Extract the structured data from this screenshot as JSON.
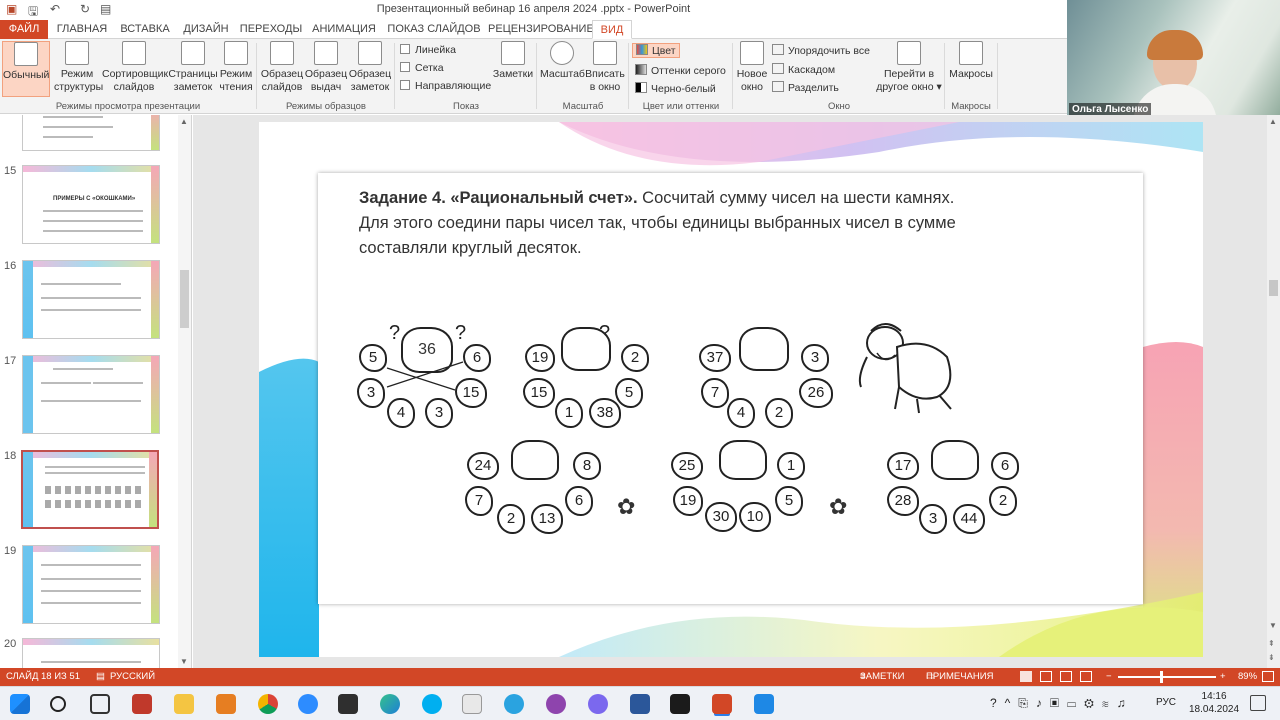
{
  "app": {
    "title": "Презентационный вебинар 16 апреля 2024 .pptx - PowerPoint",
    "quick_access": [
      "save-icon",
      "undo-icon",
      "redo-icon",
      "slideshow-icon"
    ]
  },
  "tabs": [
    "ФАЙЛ",
    "ГЛАВНАЯ",
    "ВСТАВКА",
    "ДИЗАЙН",
    "ПЕРЕХОДЫ",
    "АНИМАЦИЯ",
    "ПОКАЗ СЛАЙДОВ",
    "РЕЦЕНЗИРОВАНИЕ",
    "ВИД"
  ],
  "active_tab": "ВИД",
  "ribbon": {
    "views": {
      "normal": "Обычный",
      "outline_1": "Режим",
      "outline_2": "структуры",
      "sorter_1": "Сортировщик",
      "sorter_2": "слайдов",
      "notes_1": "Страницы",
      "notes_2": "заметок",
      "reading_1": "Режим",
      "reading_2": "чтения",
      "group": "Режимы просмотра презентации"
    },
    "masters": {
      "slide_1": "Образец",
      "slide_2": "слайдов",
      "handout_1": "Образец",
      "handout_2": "выдач",
      "notes_1": "Образец",
      "notes_2": "заметок",
      "group": "Режимы образцов"
    },
    "show": {
      "ruler": "Линейка",
      "grid": "Сетка",
      "guides": "Направляющие",
      "notes": "Заметки",
      "group": "Показ"
    },
    "zoom": {
      "zoom": "Масштаб",
      "fit_1": "Вписать",
      "fit_2": "в окно",
      "group": "Масштаб"
    },
    "color": {
      "color": "Цвет",
      "gray": "Оттенки серого",
      "bw": "Черно-белый",
      "group": "Цвет или оттенки серого"
    },
    "window": {
      "new_1": "Новое",
      "new_2": "окно",
      "arrange": "Упорядочить все",
      "cascade": "Каскадом",
      "split": "Разделить",
      "switch_1": "Перейти в",
      "switch_2": "другое окно",
      "group": "Окно"
    },
    "macros": {
      "macros": "Макросы",
      "group": "Макросы"
    }
  },
  "webcam": {
    "name": "Ольга Лысенко"
  },
  "thumbnails": {
    "numbers": [
      "15",
      "16",
      "17",
      "18",
      "19",
      "20"
    ],
    "titles": [
      "ПРИМЕРЫ С «ОКОШКАМИ»",
      "",
      "",
      "",
      "",
      ""
    ],
    "selected": "18"
  },
  "slide": {
    "task_bold": "Задание 4. «Рациональный счет».",
    "task_text": " Сосчитай сумму чисел на шести камнях. Для этого соедини пары чисел так, чтобы единицы выбранных чисел в сумме составляли круглый десяток.",
    "groups": [
      {
        "big": "36",
        "stones": [
          "5",
          "6",
          "3",
          "15",
          "4",
          "3"
        ]
      },
      {
        "big": "",
        "stones": [
          "19",
          "2",
          "15",
          "5",
          "1",
          "38"
        ]
      },
      {
        "big": "",
        "stones": [
          "37",
          "3",
          "7",
          "26",
          "4",
          "2"
        ]
      },
      {
        "big": "",
        "stones": [
          "24",
          "8",
          "7",
          "6",
          "2",
          "13"
        ]
      },
      {
        "big": "",
        "stones": [
          "25",
          "1",
          "19",
          "5",
          "30",
          "10"
        ]
      },
      {
        "big": "",
        "stones": [
          "17",
          "6",
          "28",
          "2",
          "3",
          "44"
        ]
      }
    ]
  },
  "status": {
    "slide": "СЛАЙД 18 ИЗ 51",
    "language": "РУССКИЙ",
    "notes": "ЗАМЕТКИ",
    "comments": "ПРИМЕЧАНИЯ",
    "zoom": "89%",
    "zoom_level": 0.89
  },
  "taskbar": {
    "lang": "РУС",
    "time": "14:16",
    "date": "18.04.2024"
  }
}
